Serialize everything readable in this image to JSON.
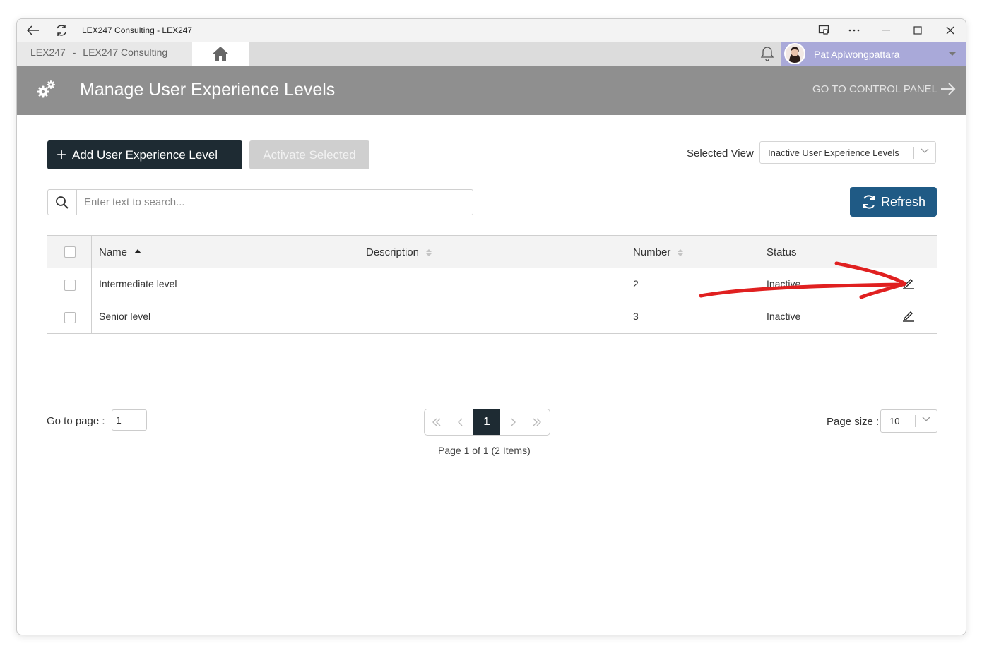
{
  "window": {
    "title": "LEX247 Consulting - LEX247"
  },
  "nav": {
    "org": "LEX247",
    "separator": "-",
    "company": "LEX247 Consulting",
    "user_name": "Pat Apiwongpattara"
  },
  "header": {
    "title": "Manage User Experience Levels",
    "control_panel_link": "GO TO CONTROL PANEL"
  },
  "toolbar": {
    "add_label": "Add User Experience Level",
    "activate_label": "Activate Selected",
    "selected_view_label": "Selected View",
    "selected_view_value": "Inactive User Experience Levels",
    "search_placeholder": "Enter text to search...",
    "refresh_label": "Refresh"
  },
  "table": {
    "columns": [
      "Name",
      "Description",
      "Number",
      "Status"
    ],
    "rows": [
      {
        "name": "Intermediate level",
        "description": "",
        "number": "2",
        "status": "Inactive"
      },
      {
        "name": "Senior level",
        "description": "",
        "number": "3",
        "status": "Inactive"
      }
    ]
  },
  "pager": {
    "goto_label": "Go to page :",
    "goto_value": "1",
    "current_page": "1",
    "info": "Page 1 of 1 (2 Items)",
    "size_label": "Page size :",
    "size_value": "10"
  },
  "colors": {
    "header_bg": "#8f8f8f",
    "primary_dark": "#1e2b33",
    "refresh_blue": "#1f5a85",
    "user_bar": "#a9a9d9",
    "annotation_red": "#e02020"
  }
}
